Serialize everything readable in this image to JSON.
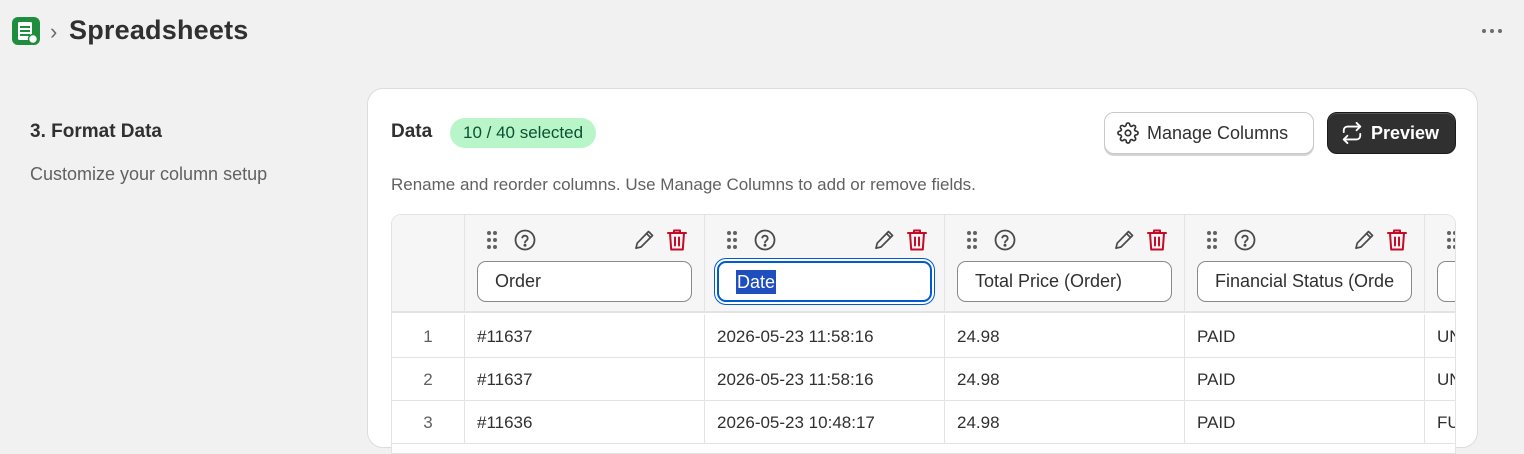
{
  "header": {
    "app_icon": "google-sheets-icon",
    "breadcrumb_separator": "›",
    "title": "Spreadsheets",
    "more_icon": "more-horizontal-icon"
  },
  "section": {
    "title": "3. Format Data",
    "description": "Customize your column setup"
  },
  "card": {
    "label": "Data",
    "badge": "10 / 40 selected",
    "manage_columns_label": "Manage Columns",
    "manage_columns_icon": "gear-icon",
    "preview_label": "Preview",
    "preview_icon": "refresh-icon",
    "help_text": "Rename and reorder columns. Use Manage Columns to add or remove fields."
  },
  "columns": [
    {
      "name": "Order",
      "focused": false
    },
    {
      "name": "Date",
      "focused": true
    },
    {
      "name": "Total Price (Order)",
      "focused": false
    },
    {
      "name": "Financial Status (Order)",
      "focused": false
    },
    {
      "name": "",
      "focused": false
    }
  ],
  "rows": [
    {
      "num": "1",
      "cells": [
        "#11637",
        "2026-05-23 11:58:16",
        "24.98",
        "PAID",
        "UNFULFILLED"
      ]
    },
    {
      "num": "2",
      "cells": [
        "#11637",
        "2026-05-23 11:58:16",
        "24.98",
        "PAID",
        "UNFULFILLED"
      ]
    },
    {
      "num": "3",
      "cells": [
        "#11636",
        "2026-05-23 10:48:17",
        "24.98",
        "PAID",
        "FULFILLED"
      ]
    }
  ],
  "colors": {
    "accent_focus": "#005bd3",
    "badge_bg": "#b8f5c8",
    "badge_text": "#0c5132",
    "delete_red": "#c70a24",
    "primary_button": "#303030"
  }
}
